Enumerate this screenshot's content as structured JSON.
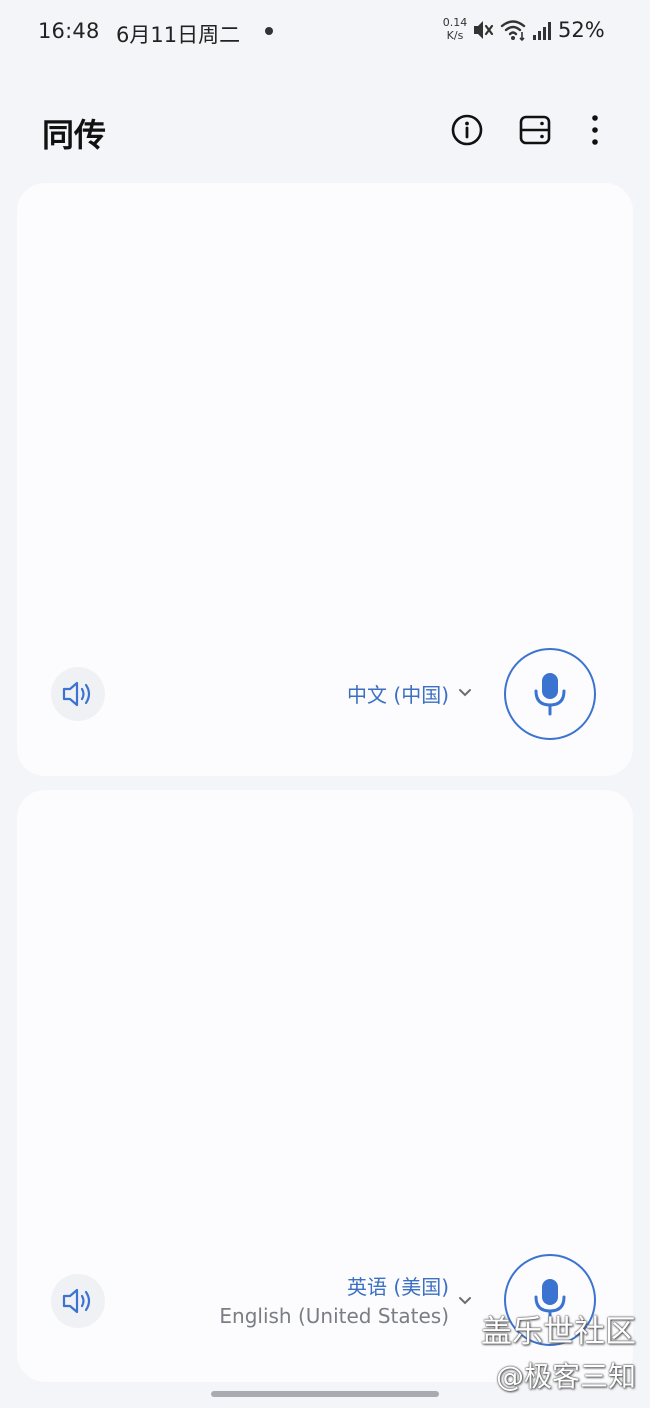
{
  "status_bar": {
    "time": "16:48",
    "date": "6月11日周二",
    "net_speed_value": "0.14",
    "net_speed_unit": "K/s",
    "battery": "52%"
  },
  "app_bar": {
    "title": "同传",
    "actions": [
      {
        "icon": "info-icon"
      },
      {
        "icon": "split-view-icon"
      },
      {
        "icon": "more-vertical-icon"
      }
    ]
  },
  "panels": {
    "top": {
      "language": "中文 (中国)",
      "secondary_language": ""
    },
    "bottom": {
      "language": "英语 (美国)",
      "secondary_language": "English (United States)"
    }
  },
  "watermark": {
    "line1": "盖乐世社区",
    "line2": "@极客三知"
  },
  "colors": {
    "accent": "#3a73d0",
    "background": "#f4f5f8",
    "panel": "#fcfcfe"
  }
}
